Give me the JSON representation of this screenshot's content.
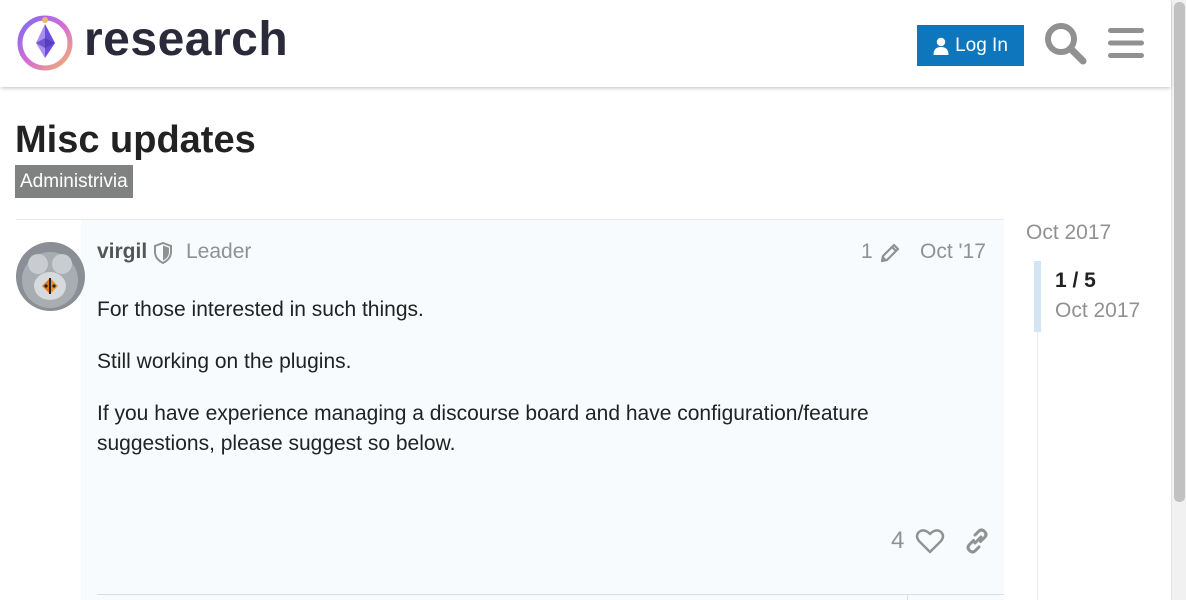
{
  "header": {
    "logo_text": "research",
    "login_label": "Log In"
  },
  "topic": {
    "title": "Misc updates",
    "category": "Administrivia"
  },
  "post": {
    "username": "virgil",
    "user_title": "Leader",
    "edit_count": "1",
    "date": "Oct '17",
    "paragraphs": [
      "For those interested in such things.",
      "Still working on the plugins.",
      "If you have experience managing a discourse board and have configuration/feature suggestions, please suggest so below."
    ],
    "like_count": "4"
  },
  "timeline": {
    "top_date": "Oct 2017",
    "counter": "1 / 5",
    "current_date": "Oct 2017"
  },
  "colors": {
    "accent": "#0e76bd",
    "category_bg": "#808281",
    "post_bg": "#f7fbfd",
    "muted_text": "#919191"
  },
  "icons": [
    "logo-icon",
    "user-icon",
    "search-icon",
    "menu-icon",
    "shield-icon",
    "pencil-icon",
    "heart-icon",
    "link-icon"
  ]
}
